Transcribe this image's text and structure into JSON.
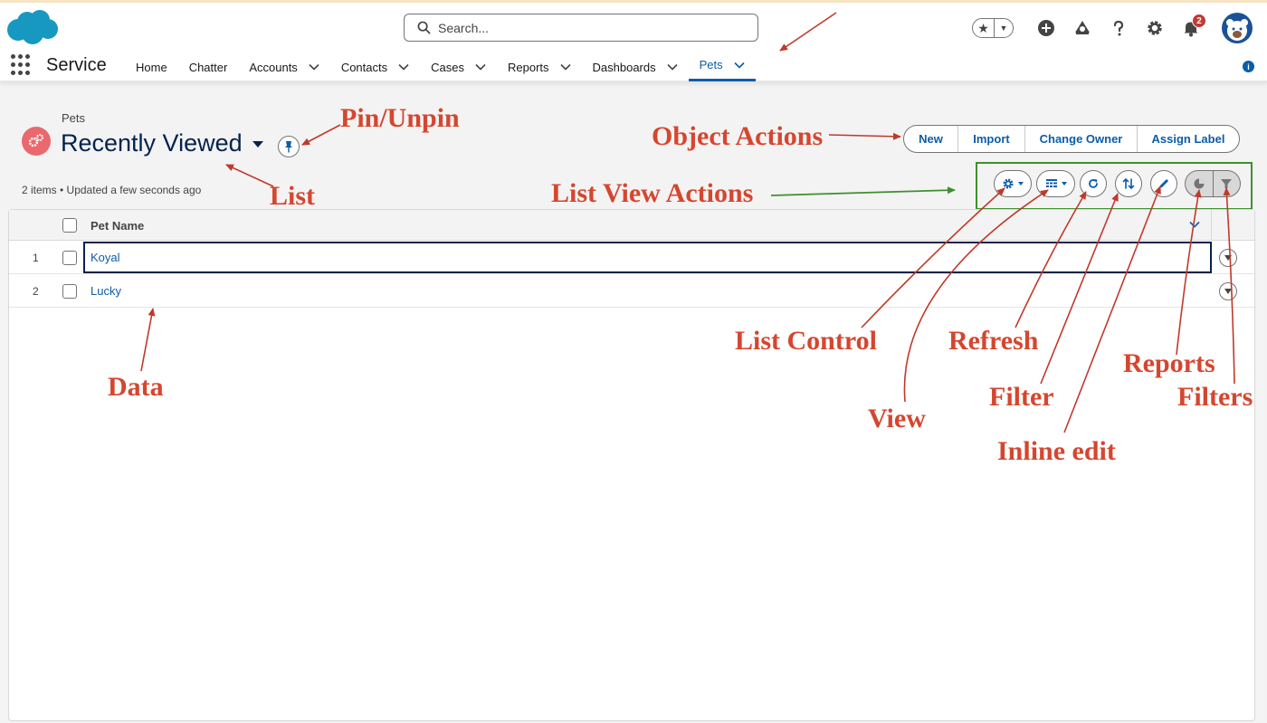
{
  "header": {
    "search_placeholder": "Search...",
    "notification_count": "2"
  },
  "nav": {
    "app_name": "Service",
    "items": [
      {
        "label": "Home",
        "has_menu": false
      },
      {
        "label": "Chatter",
        "has_menu": false
      },
      {
        "label": "Accounts",
        "has_menu": true
      },
      {
        "label": "Contacts",
        "has_menu": true
      },
      {
        "label": "Cases",
        "has_menu": true
      },
      {
        "label": "Reports",
        "has_menu": true
      },
      {
        "label": "Dashboards",
        "has_menu": true
      },
      {
        "label": "Pets",
        "has_menu": true,
        "active": true
      }
    ],
    "info_glyph": "i"
  },
  "list": {
    "object_label": "Pets",
    "title": "Recently Viewed",
    "meta": "2 items • Updated a few seconds ago"
  },
  "object_actions": [
    "New",
    "Import",
    "Change Owner",
    "Assign Label"
  ],
  "table": {
    "column_header": "Pet Name",
    "rows": [
      {
        "num": "1",
        "name": "Koyal"
      },
      {
        "num": "2",
        "name": "Lucky"
      }
    ]
  },
  "annotations": {
    "pin_unpin": "Pin/Unpin",
    "list": "List",
    "object_actions": "Object Actions",
    "list_view_actions": "List View Actions",
    "data": "Data",
    "list_control": "List Control",
    "refresh": "Refresh",
    "reports": "Reports",
    "filter": "Filter",
    "filters": "Filters",
    "view": "View",
    "inline_edit": "Inline edit"
  },
  "colors": {
    "brand": "#0b5cab",
    "annotation": "#d5462f",
    "highlight_box": "#3f8f2e",
    "object_icon": "#e9696e"
  }
}
